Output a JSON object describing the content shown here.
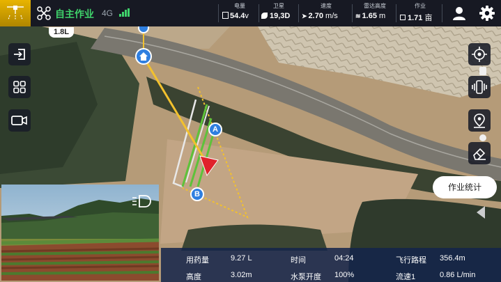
{
  "app": {
    "mode_label": "自主作业",
    "network": "4G"
  },
  "status": {
    "battery": {
      "label": "电量",
      "value": "54.4",
      "unit": "v"
    },
    "satellite": {
      "label": "卫星",
      "value": "19,3D"
    },
    "speed": {
      "label": "速度",
      "value": "2.70",
      "unit": "m/s"
    },
    "radar_height": {
      "label": "雷达高度",
      "value": "1.65",
      "unit": "m"
    },
    "work_area": {
      "label": "作业",
      "value": "1.71",
      "unit": "亩"
    }
  },
  "tank_level": "1.8L",
  "route_markers": {
    "start": "A",
    "end": "B"
  },
  "right_panel": {
    "work_stats_label": "作业统计"
  },
  "telemetry": {
    "dosage_label": "用药量",
    "dosage_value": "9.27 L",
    "time_label": "时间",
    "time_value": "04:24",
    "flight_distance_label": "飞行路程",
    "flight_distance_value": "356.4m",
    "height_label": "高度",
    "height_value": "3.02m",
    "pump_label": "水泵开度",
    "pump_value": "100%",
    "flow_label": "流速1",
    "flow_value": "0.86 L/min"
  },
  "colors": {
    "mode_green": "#3fd36b",
    "route_yellow": "#f2c12e",
    "sprayed_green": "#5ec23a",
    "heading_red": "#e0222b",
    "marker_blue": "#2f7fe0",
    "telemetry_bg": "#14244a"
  },
  "icons": [
    "app-logo-icon",
    "drone-icon",
    "signal-bars-icon",
    "battery-icon",
    "satellite-icon",
    "speed-icon",
    "radar-icon",
    "area-icon",
    "user-icon",
    "gear-icon",
    "exit-icon",
    "grid-icon",
    "camera-icon",
    "locate-icon",
    "vibrate-icon",
    "map-pin-icon",
    "eraser-icon",
    "home-icon",
    "camera-toggle-icon",
    "collapse-arrow-icon"
  ]
}
